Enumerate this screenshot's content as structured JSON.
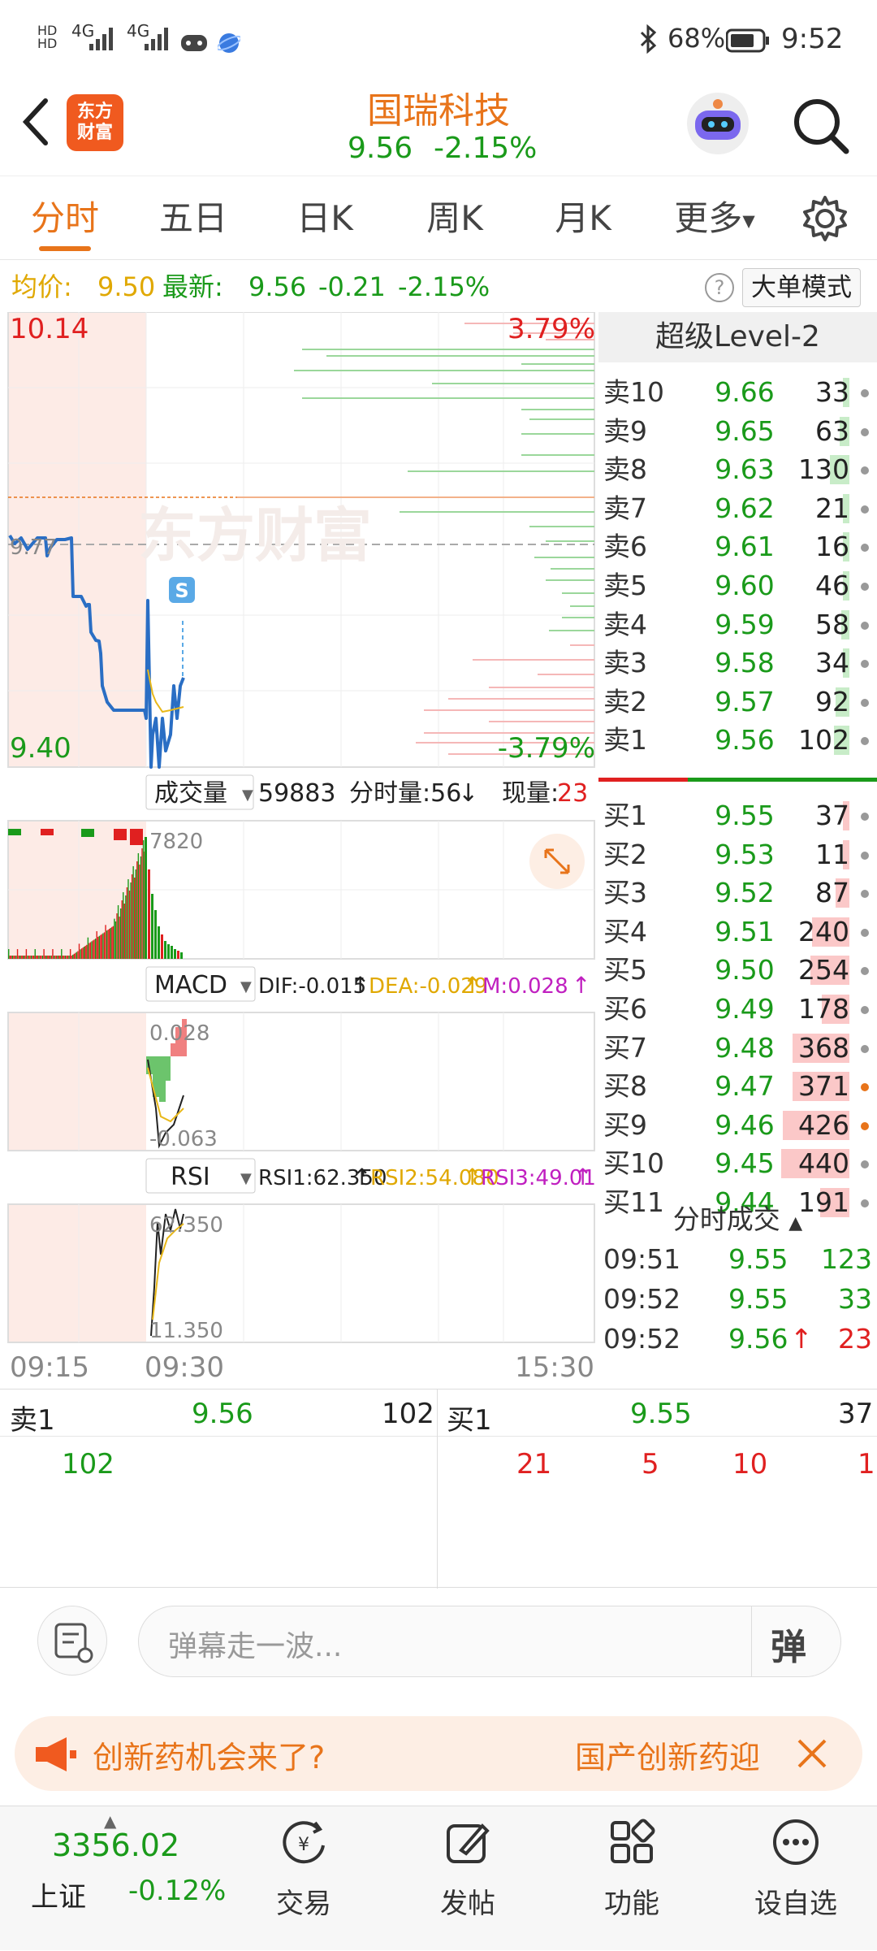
{
  "status_bar": {
    "signal1": "4G",
    "signal2": "4G",
    "battery": "68%",
    "time": "9:52"
  },
  "header": {
    "logo_text_1": "东方",
    "logo_text_2": "财富",
    "stock_name": "国瑞科技",
    "price": "9.56",
    "change_pct": "-2.15%"
  },
  "tabs": [
    "分时",
    "五日",
    "日K",
    "周K",
    "月K",
    "更多"
  ],
  "info_bar": {
    "avg_label": "均价:",
    "avg_value": "9.50",
    "latest_label": "最新:",
    "latest_value": "9.56",
    "change": "-0.21",
    "change_pct": "-2.15%",
    "big_order_mode": "大单模式"
  },
  "chart": {
    "price_high": "10.14",
    "price_low": "9.40",
    "pct_high": "3.79%",
    "pct_low": "-3.79%",
    "ref_price": "9.77",
    "watermark": "东方财富",
    "s_marker": "S",
    "time_start": "09:15",
    "time_mid": "09:30",
    "time_end": "15:30",
    "colors": {
      "price_line": "#2a6ec4",
      "avg_line": "#e8b81a",
      "up": "#e02020",
      "down": "#1a9a1a"
    },
    "volume": {
      "label": "成交量",
      "total": "59883",
      "minute_label": "分时量:56",
      "minute_arrow": "↓",
      "now_label": "现量:",
      "now_value": "23",
      "max_label": "7820"
    },
    "macd": {
      "label": "MACD",
      "dif": "DIF:-0.015",
      "dea": "DEA:-0.029",
      "m": "M:0.028",
      "arrow": "↑",
      "top": "0.028",
      "bottom": "-0.063"
    },
    "rsi": {
      "label": "RSI",
      "rsi1": "RSI1:62.350",
      "rsi2": "RSI2:54.080",
      "rsi3": "RSI3:49.010",
      "arrow": "↑",
      "top": "62.350",
      "bottom": "11.350"
    }
  },
  "order_book": {
    "title": "超级Level-2",
    "sells": [
      {
        "label": "卖10",
        "price": "9.66",
        "vol": "33",
        "fill": 0.03
      },
      {
        "label": "卖9",
        "price": "9.65",
        "vol": "63",
        "fill": 0.05
      },
      {
        "label": "卖8",
        "price": "9.63",
        "vol": "130",
        "fill": 0.1
      },
      {
        "label": "卖7",
        "price": "9.62",
        "vol": "21",
        "fill": 0.02
      },
      {
        "label": "卖6",
        "price": "9.61",
        "vol": "16",
        "fill": 0.02
      },
      {
        "label": "卖5",
        "price": "9.60",
        "vol": "46",
        "fill": 0.03
      },
      {
        "label": "卖4",
        "price": "9.59",
        "vol": "58",
        "fill": 0.04
      },
      {
        "label": "卖3",
        "price": "9.58",
        "vol": "34",
        "fill": 0.03
      },
      {
        "label": "卖2",
        "price": "9.57",
        "vol": "92",
        "fill": 0.07
      },
      {
        "label": "卖1",
        "price": "9.56",
        "vol": "102",
        "fill": 0.08
      }
    ],
    "buys": [
      {
        "label": "买1",
        "price": "9.55",
        "vol": "37",
        "fill": 0.03
      },
      {
        "label": "买2",
        "price": "9.53",
        "vol": "11",
        "fill": 0.01
      },
      {
        "label": "买3",
        "price": "9.52",
        "vol": "87",
        "fill": 0.07
      },
      {
        "label": "买4",
        "price": "9.51",
        "vol": "240",
        "fill": 0.19
      },
      {
        "label": "买5",
        "price": "9.50",
        "vol": "254",
        "fill": 0.2
      },
      {
        "label": "买6",
        "price": "9.49",
        "vol": "178",
        "fill": 0.14
      },
      {
        "label": "买7",
        "price": "9.48",
        "vol": "368",
        "fill": 0.29
      },
      {
        "label": "买8",
        "price": "9.47",
        "vol": "371",
        "fill": 0.29
      },
      {
        "label": "买9",
        "price": "9.46",
        "vol": "426",
        "fill": 0.34
      },
      {
        "label": "买10",
        "price": "9.45",
        "vol": "440",
        "fill": 0.35
      },
      {
        "label": "买11",
        "price": "9.44",
        "vol": "191",
        "fill": 0.15
      }
    ],
    "trades_title": "分时成交",
    "trades": [
      {
        "time": "09:51",
        "price": "9.55",
        "vol": "123",
        "arrow": ""
      },
      {
        "time": "09:52",
        "price": "9.55",
        "vol": "33",
        "arrow": ""
      },
      {
        "time": "09:52",
        "price": "9.56",
        "vol": "23",
        "arrow": "↑"
      }
    ]
  },
  "bottom_table": {
    "sell_label": "卖1",
    "sell_price": "9.56",
    "sell_vol": "102",
    "buy_label": "买1",
    "buy_price": "9.55",
    "buy_vol": "37",
    "sell_detail": [
      "102"
    ],
    "buy_detail": [
      "21",
      "5",
      "10",
      "1"
    ]
  },
  "danmu": {
    "placeholder": "弹幕走一波...",
    "button": "弹"
  },
  "ad": {
    "text_left": "创新药机会来了?",
    "text_right": "国产创新药迎"
  },
  "bottom_nav": {
    "index_value": "3356.02",
    "index_name": "上证",
    "index_change": "-0.12%",
    "items": [
      "交易",
      "发帖",
      "功能",
      "设自选"
    ]
  }
}
